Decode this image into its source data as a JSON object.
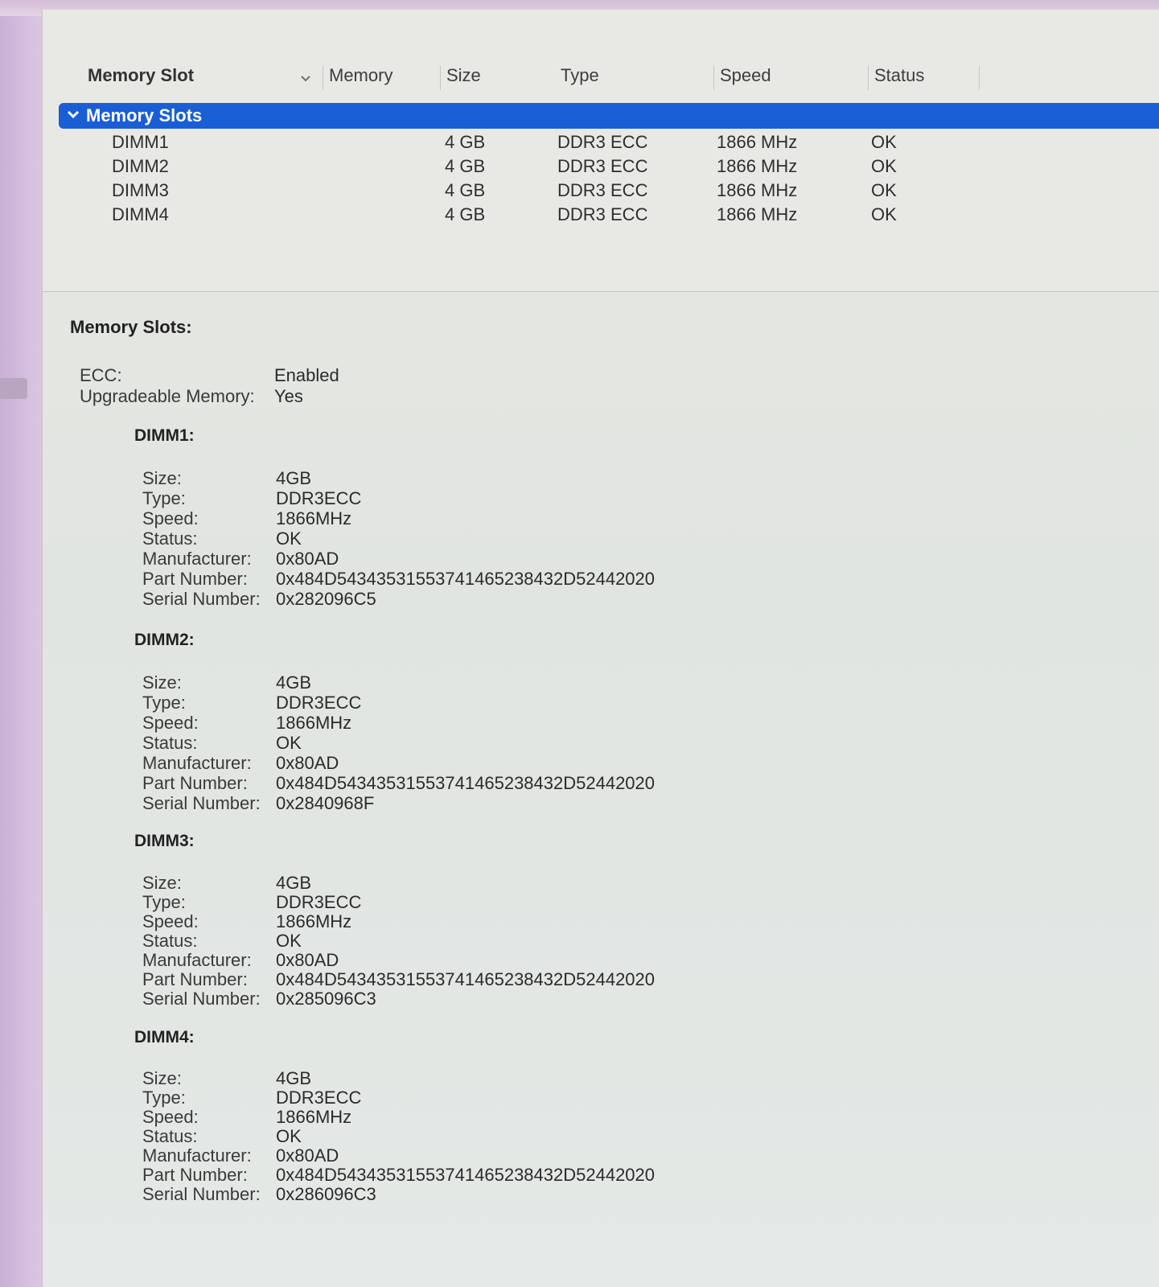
{
  "table": {
    "columns": [
      {
        "label": "Memory Slot"
      },
      {
        "label": "Memory"
      },
      {
        "label": "Size"
      },
      {
        "label": "Type"
      },
      {
        "label": "Speed"
      },
      {
        "label": "Status"
      }
    ],
    "group_label": "Memory Slots",
    "rows": [
      {
        "name": "DIMM1",
        "size": "4 GB",
        "type": "DDR3 ECC",
        "speed": "1866 MHz",
        "status": "OK"
      },
      {
        "name": "DIMM2",
        "size": "4 GB",
        "type": "DDR3 ECC",
        "speed": "1866 MHz",
        "status": "OK"
      },
      {
        "name": "DIMM3",
        "size": "4 GB",
        "type": "DDR3 ECC",
        "speed": "1866 MHz",
        "status": "OK"
      },
      {
        "name": "DIMM4",
        "size": "4 GB",
        "type": "DDR3 ECC",
        "speed": "1866 MHz",
        "status": "OK"
      }
    ]
  },
  "detail": {
    "title": "Memory Slots:",
    "general": [
      {
        "key": "ECC:",
        "value": "Enabled"
      },
      {
        "key": "Upgradeable Memory:",
        "value": "Yes"
      }
    ],
    "dimms": [
      {
        "title": "DIMM1:",
        "fields": [
          {
            "key": "Size:",
            "value": "4 GB"
          },
          {
            "key": "Type:",
            "value": "DDR3 ECC"
          },
          {
            "key": "Speed:",
            "value": "1866 MHz"
          },
          {
            "key": "Status:",
            "value": "OK"
          },
          {
            "key": "Manufacturer:",
            "value": "0x80AD"
          },
          {
            "key": "Part Number:",
            "value": "0x484D5434353155374146523843 2D52442020"
          },
          {
            "key": "Serial Number:",
            "value": "0x282096C5"
          }
        ]
      },
      {
        "title": "DIMM2:",
        "fields": [
          {
            "key": "Size:",
            "value": "4 GB"
          },
          {
            "key": "Type:",
            "value": "DDR3 ECC"
          },
          {
            "key": "Speed:",
            "value": "1866 MHz"
          },
          {
            "key": "Status:",
            "value": "OK"
          },
          {
            "key": "Manufacturer:",
            "value": "0x80AD"
          },
          {
            "key": "Part Number:",
            "value": "0x484D5434353155374146523843 2D52442020"
          },
          {
            "key": "Serial Number:",
            "value": "0x2840968F"
          }
        ]
      },
      {
        "title": "DIMM3:",
        "fields": [
          {
            "key": "Size:",
            "value": "4 GB"
          },
          {
            "key": "Type:",
            "value": "DDR3 ECC"
          },
          {
            "key": "Speed:",
            "value": "1866 MHz"
          },
          {
            "key": "Status:",
            "value": "OK"
          },
          {
            "key": "Manufacturer:",
            "value": "0x80AD"
          },
          {
            "key": "Part Number:",
            "value": "0x484D5434353155374146523843 2D52442020"
          },
          {
            "key": "Serial Number:",
            "value": "0x285096C3"
          }
        ]
      },
      {
        "title": "DIMM4:",
        "fields": [
          {
            "key": "Size:",
            "value": "4 GB"
          },
          {
            "key": "Type:",
            "value": "DDR3 ECC"
          },
          {
            "key": "Speed:",
            "value": "1866 MHz"
          },
          {
            "key": "Status:",
            "value": "OK"
          },
          {
            "key": "Manufacturer:",
            "value": "0x80AD"
          },
          {
            "key": "Part Number:",
            "value": "0x484D5434353155374146523843 2D52442020"
          },
          {
            "key": "Serial Number:",
            "value": "0x286096C3"
          }
        ]
      }
    ]
  },
  "colors": {
    "selection": "#1a5ed6",
    "window_bg": "#e6e8e3",
    "desktop": "#d9c3dd"
  },
  "icons": {
    "sort_indicator": "chevron-down-icon",
    "group_disclosure": "disclosure-chevron-icon"
  }
}
